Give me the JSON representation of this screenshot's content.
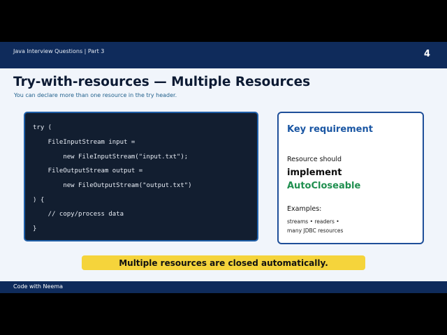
{
  "header": {
    "series": "Java Interview Questions | Part 3",
    "page_number": "4"
  },
  "main": {
    "title": "Try-with-resources — Multiple Resources",
    "subtitle": "You can declare more than one resource in the try header."
  },
  "code": {
    "lines": [
      "try (",
      "    FileInputStream input =",
      "        new FileInputStream(\"input.txt\");",
      "    FileOutputStream output =",
      "        new FileOutputStream(\"output.txt\")",
      ") {",
      "    // copy/process data",
      "}"
    ]
  },
  "card": {
    "heading": "Key requirement",
    "resource_text": "Resource should",
    "implement": "implement",
    "interface_name": "AutoCloseable",
    "examples_label": "Examples:",
    "examples_line1": "streams • readers •",
    "examples_line2": "many JDBC resources"
  },
  "callout": {
    "text": "Multiple resources are closed automatically."
  },
  "footer": {
    "brand": "Code with Neema"
  },
  "colors": {
    "header_bg": "#0f2b5b",
    "code_bg": "#121e30",
    "accent_blue": "#1a56a3",
    "accent_green": "#1f8f4f",
    "callout_yellow": "#f5d43b"
  }
}
